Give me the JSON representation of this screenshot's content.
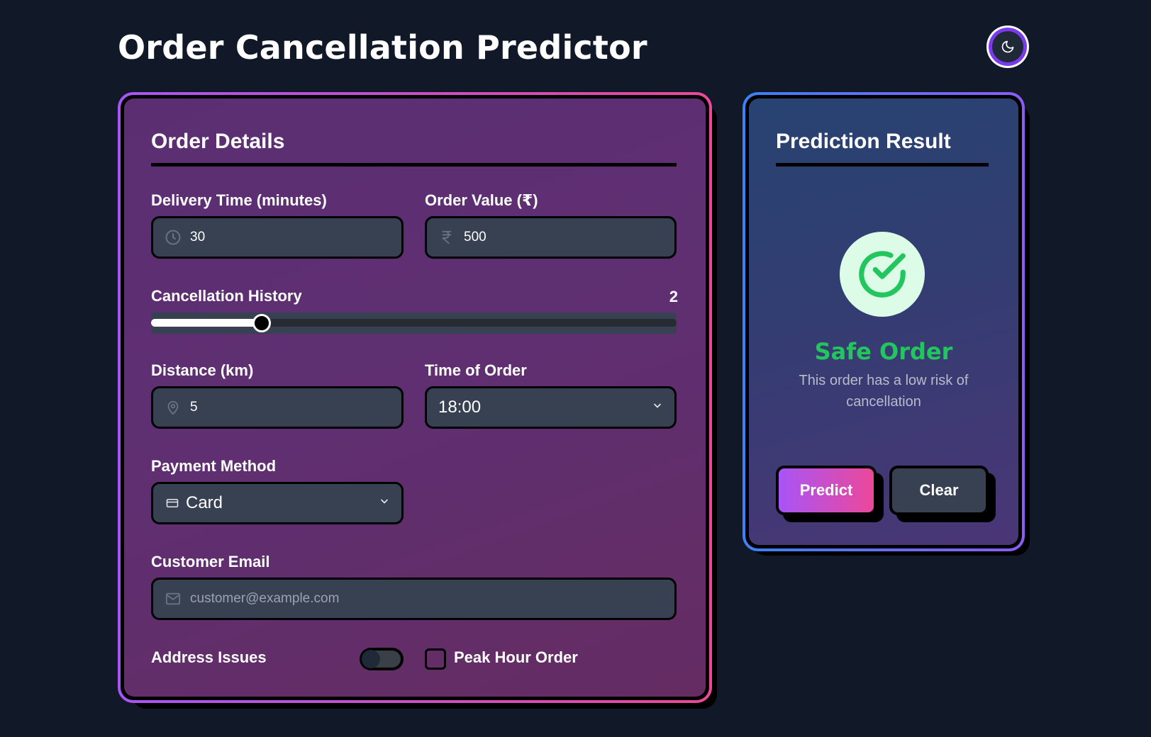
{
  "app": {
    "title": "Order Cancellation Predictor"
  },
  "theme_toggle": {
    "icon": "moon-icon"
  },
  "order_details": {
    "title": "Order Details",
    "delivery_time": {
      "label": "Delivery Time (minutes)",
      "value": "30",
      "icon": "clock-icon"
    },
    "order_value": {
      "label": "Order Value (₹)",
      "value": "500",
      "icon": "rupee-icon"
    },
    "cancellation_history": {
      "label": "Cancellation History",
      "value": "2",
      "fraction": 0.21
    },
    "distance": {
      "label": "Distance (km)",
      "value": "5",
      "icon": "map-pin-icon"
    },
    "time_of_order": {
      "label": "Time of Order",
      "value": "18:00"
    },
    "payment_method": {
      "label": "Payment Method",
      "value": "Card",
      "icon": "credit-card-icon"
    },
    "customer_email": {
      "label": "Customer Email",
      "placeholder": "customer@example.com",
      "icon": "mail-icon"
    },
    "address_issues": {
      "label": "Address Issues",
      "checked": false
    },
    "peak_hour": {
      "label": "Peak Hour Order",
      "checked": false
    }
  },
  "prediction": {
    "title": "Prediction Result",
    "status": "Safe Order",
    "description": "This order has a low risk of cancellation",
    "status_color": "#22c55e",
    "predict_label": "Predict",
    "clear_label": "Clear"
  }
}
